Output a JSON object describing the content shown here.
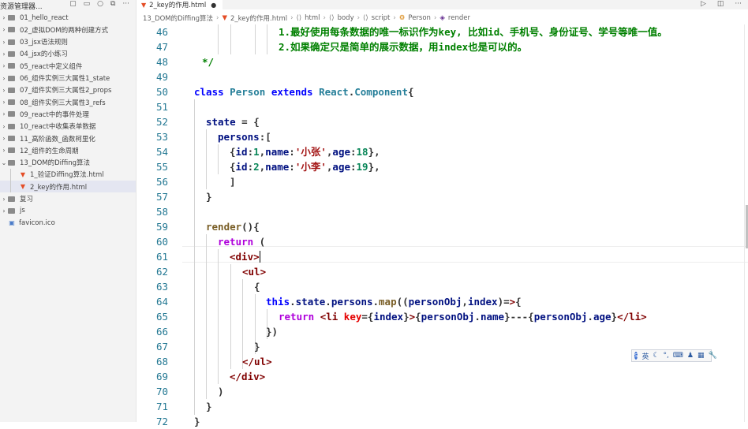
{
  "sidebar": {
    "title": "资源管理器...",
    "items": [
      {
        "label": "01_hello_react",
        "type": "folder",
        "open": false
      },
      {
        "label": "02_虚拟DOM的两种创建方式",
        "type": "folder",
        "open": false
      },
      {
        "label": "03_jsx语法规则",
        "type": "folder",
        "open": false
      },
      {
        "label": "04_jsx的小练习",
        "type": "folder",
        "open": false
      },
      {
        "label": "05_react中定义组件",
        "type": "folder",
        "open": false
      },
      {
        "label": "06_组件实例三大属性1_state",
        "type": "folder",
        "open": false
      },
      {
        "label": "07_组件实例三大属性2_props",
        "type": "folder",
        "open": false
      },
      {
        "label": "08_组件实例三大属性3_refs",
        "type": "folder",
        "open": false
      },
      {
        "label": "09_react中的事件处理",
        "type": "folder",
        "open": false
      },
      {
        "label": "10_react中收集表单数据",
        "type": "folder",
        "open": false
      },
      {
        "label": "11_高阶函数_函数柯里化",
        "type": "folder",
        "open": false
      },
      {
        "label": "12_组件的生命周期",
        "type": "folder",
        "open": false
      },
      {
        "label": "13_DOM的Diffing算法",
        "type": "folder",
        "open": true
      },
      {
        "label": "1_验证Diffing算法.html",
        "type": "html",
        "open": false
      },
      {
        "label": "2_key的作用.html",
        "type": "html",
        "open": false
      },
      {
        "label": "复习",
        "type": "folder",
        "open": false
      },
      {
        "label": "js",
        "type": "folder",
        "open": false
      },
      {
        "label": "favicon.ico",
        "type": "ico",
        "open": false
      }
    ]
  },
  "tab": {
    "label": "2_key的作用.html",
    "dirty_marker": "●"
  },
  "breadcrumb": [
    "13_DOM的Diffing算法",
    "2_key的作用.html",
    "html",
    "body",
    "script",
    "Person",
    "render"
  ],
  "editor": {
    "lines": [
      {
        "no": "46",
        "text": "1.最好使用每条数据的唯一标识作为key, 比如id、手机号、身份证号、学号等唯一值。"
      },
      {
        "no": "47",
        "text": "2.如果确定只是简单的展示数据，用index也是可以的。"
      },
      {
        "no": "48",
        "text": "*/"
      },
      {
        "no": "49",
        "text": ""
      },
      {
        "no": "50",
        "text": "class Person extends React.Component{"
      },
      {
        "no": "51",
        "text": ""
      },
      {
        "no": "52",
        "text": "state = {"
      },
      {
        "no": "53",
        "text": "persons:["
      },
      {
        "no": "54",
        "text": "{id:1,name:'小张',age:18},"
      },
      {
        "no": "55",
        "text": "{id:2,name:'小李',age:19},"
      },
      {
        "no": "56",
        "text": "]"
      },
      {
        "no": "57",
        "text": "}"
      },
      {
        "no": "58",
        "text": ""
      },
      {
        "no": "59",
        "text": "render(){"
      },
      {
        "no": "60",
        "text": "return ("
      },
      {
        "no": "61",
        "text": "<div>"
      },
      {
        "no": "62",
        "text": "<ul>"
      },
      {
        "no": "63",
        "text": "{"
      },
      {
        "no": "64",
        "text": "this.state.persons.map((personObj,index)=>{"
      },
      {
        "no": "65",
        "text": "return <li key={index}>{personObj.name}---{personObj.age}</li>"
      },
      {
        "no": "66",
        "text": "})"
      },
      {
        "no": "67",
        "text": "}"
      },
      {
        "no": "68",
        "text": "</ul>"
      },
      {
        "no": "69",
        "text": "</div>"
      },
      {
        "no": "70",
        "text": ")"
      },
      {
        "no": "71",
        "text": "}"
      },
      {
        "no": "72",
        "text": "}"
      }
    ]
  },
  "ime": {
    "mode_label": "英"
  },
  "colors": {
    "comment": "#008000",
    "keyword": "#0000ff",
    "class": "#267f99",
    "line_number": "#237893"
  }
}
